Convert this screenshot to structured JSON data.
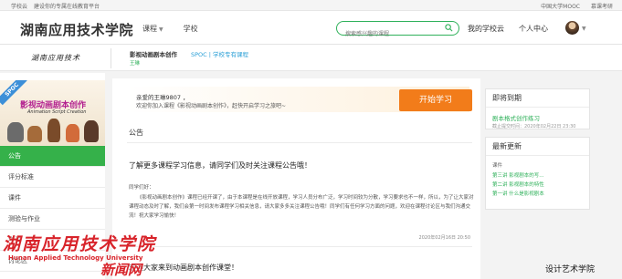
{
  "topbar": {
    "left_items": [
      "学校云",
      "建设你的专属在线教育平台"
    ],
    "right_items": [
      "中国大学MOOC",
      "慕课考研"
    ]
  },
  "header": {
    "logo": "湖南应用技术学院",
    "nav": [
      "课程",
      "学校"
    ],
    "search_placeholder": "搜索感兴趣的课程",
    "links": [
      "我的学校云",
      "个人中心"
    ]
  },
  "course": {
    "school_logo_text": "湖南应用技术",
    "title": "影视动画剧本创作",
    "tag": "SPOC | 学校专有课程",
    "teacher": "王琳",
    "cover_badge": "SPOC",
    "cover_title": "影视动画剧本创作",
    "cover_subtitle": "Animation Script Creation"
  },
  "sidebar": {
    "items": [
      "公告",
      "评分标准",
      "课件",
      "测验与作业",
      "考试",
      "讨论区"
    ],
    "active_index": 0
  },
  "welcome": {
    "line1": "亲爱的王琳9807          ，",
    "line2": "欢迎你加入课程《影视动画剧本创作》，赶快开启学习之旅吧~",
    "button": "开始学习"
  },
  "notices": {
    "section_title": "公告",
    "ann1_title": "了解更多课程学习信息，请同学们及时关注课程公告哦！",
    "ann1_greeting": "同学们好：",
    "ann1_body": "《影视动画剧本创作》课程已经开课了，由于本课程是在线开放课程，学习人员分布广泛，学习时间较为分散，学习要求也不一样，所以，为了让大家对课程动态及时了解，我们会第一时间发布课程学习相关信息，请大家多多关注课程公告哦！同学们有任何学习方面的问题，欢迎在课程讨论区与我们沟通交流！祝大家学习愉快！",
    "ann1_date": "2020年02月16日 20:50",
    "ann2_title": "欢迎大家来到动画剧本创作课堂！"
  },
  "right": {
    "due_title": "即将到期",
    "due_item": "剧本格式创作练习",
    "due_time": "截止提交时间：2020年02月22日 23:30",
    "update_title": "最新更新",
    "update_label": "课件",
    "updates": [
      "第三讲  影视剧本的写...",
      "第二讲  影视剧本的特性",
      "第一讲  什么是影视剧本"
    ]
  },
  "watermarks": {
    "school_cn": "湖南应用技术学院",
    "school_en": "Hunan Applied Technology University",
    "news": "新闻网",
    "dept": "设计艺术学院"
  },
  "colors": {
    "accent_green": "#35b14a",
    "orange": "#f27c1a",
    "link_blue": "#2a9fd6",
    "watermark_red": "#d8232a"
  }
}
